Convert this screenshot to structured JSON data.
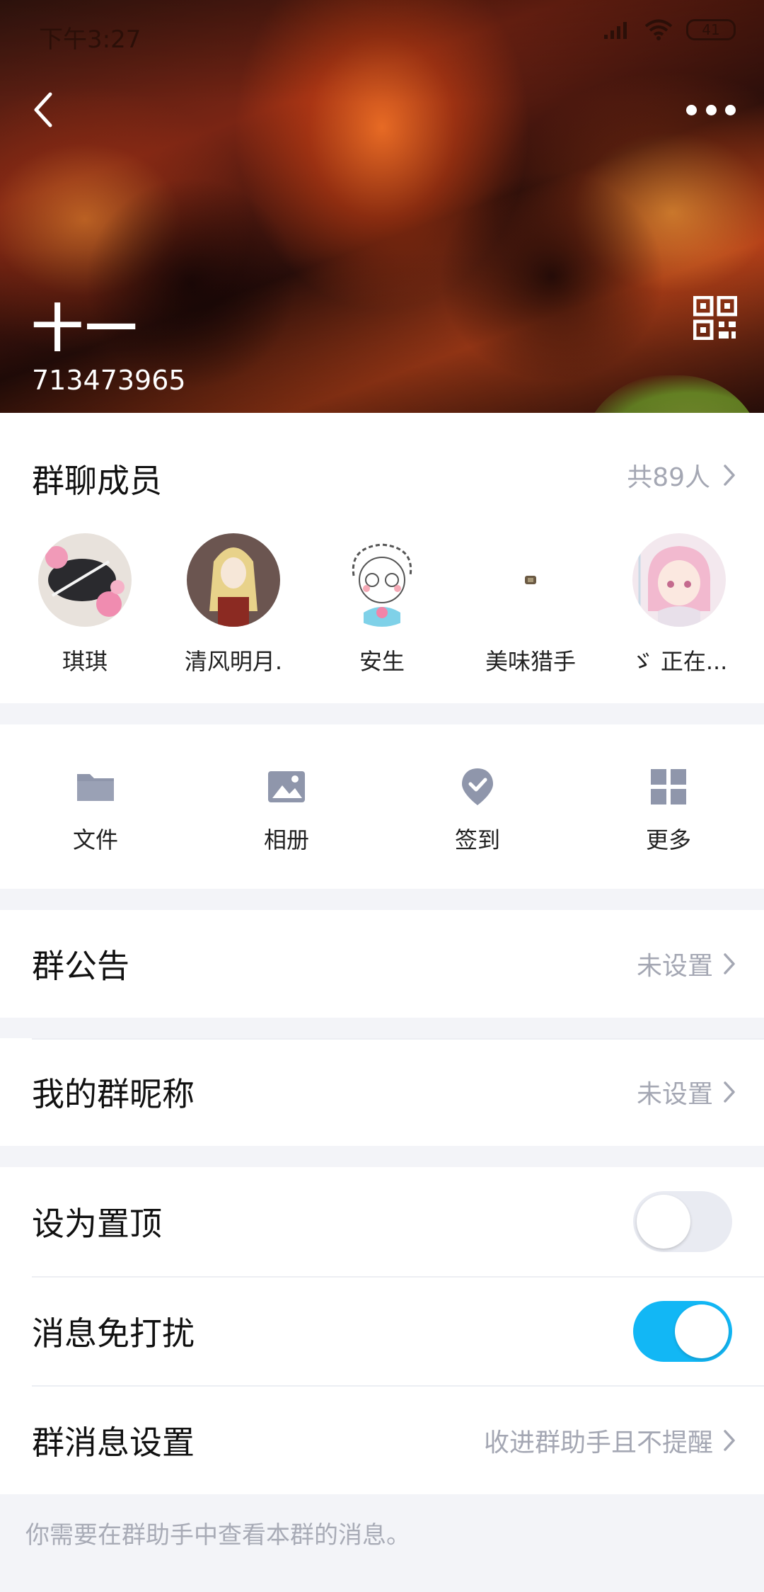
{
  "status_bar": {
    "time": "下午3:27",
    "battery": "41"
  },
  "header": {
    "group_name": "十一",
    "group_id": "713473965"
  },
  "members": {
    "title": "群聊成员",
    "count": "共89人",
    "list": [
      {
        "name": "琪琪"
      },
      {
        "name": "清风明月."
      },
      {
        "name": "安生"
      },
      {
        "name": "美味猎手"
      },
      {
        "name": "ゞ 正在..."
      }
    ]
  },
  "tools": [
    {
      "label": "文件",
      "icon": "folder-icon"
    },
    {
      "label": "相册",
      "icon": "album-icon"
    },
    {
      "label": "签到",
      "icon": "check-in-icon"
    },
    {
      "label": "更多",
      "icon": "grid-icon"
    }
  ],
  "announcement": {
    "label": "群公告",
    "value": "未设置"
  },
  "nickname": {
    "label": "我的群昵称",
    "value": "未设置"
  },
  "pin_top": {
    "label": "设为置顶",
    "on": false
  },
  "do_not_disturb": {
    "label": "消息免打扰",
    "on": true
  },
  "message_settings": {
    "label": "群消息设置",
    "value": "收进群助手且不提醒"
  },
  "footnote": "你需要在群助手中查看本群的消息。",
  "colors": {
    "accent": "#12b7f5",
    "secondary_text": "#a4a7b3",
    "background": "#f3f4f8"
  }
}
